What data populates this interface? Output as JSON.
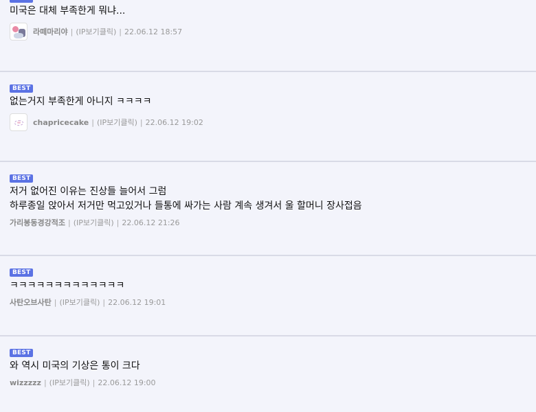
{
  "badge_label": "BEST",
  "ip_label": "(IP보기클릭)",
  "comments": [
    {
      "text": [
        "미국은 대체 부족한게 뭐냐..."
      ],
      "nick": "라떼마리야",
      "date": "22.06.12 18:57",
      "avatar": "avatar-anime-icon"
    },
    {
      "text": [
        "없는거지 부족한게 아니지 ㅋㅋㅋㅋ"
      ],
      "nick": "chapricecake",
      "date": "22.06.12 19:02",
      "avatar": "avatar-cake-icon"
    },
    {
      "text": [
        "저거 없어진 이유는 진상들 늘어서 그럼",
        "하루종일 앉아서 저거만 먹고있거나 들통에 싸가는 사람 계속 생겨서 울 할머니 장사접음"
      ],
      "nick": "가리봉동경강적조",
      "date": "22.06.12 21:26"
    },
    {
      "text": [
        "ㅋㅋㅋㅋㅋㅋㅋㅋㅋㅋㅋㅋㅋ"
      ],
      "nick": "사탄오브사탄",
      "date": "22.06.12 19:01"
    },
    {
      "text": [
        "와 역시 미국의 기상은 통이 크다"
      ],
      "nick": "wizzzzz",
      "date": "22.06.12 19:00"
    }
  ]
}
